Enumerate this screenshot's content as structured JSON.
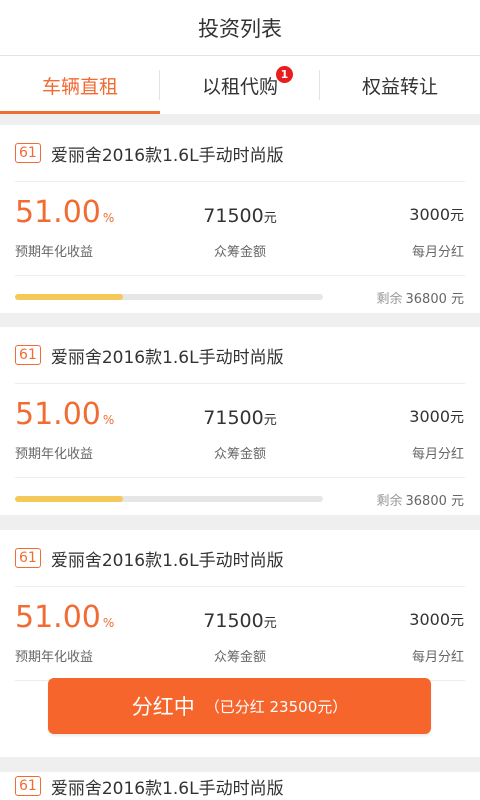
{
  "header": {
    "title": "投资列表"
  },
  "tabs": [
    {
      "label": "车辆直租",
      "active": true
    },
    {
      "label": "以租代购",
      "badge": "1"
    },
    {
      "label": "权益转让"
    }
  ],
  "colors": {
    "accent": "#f26b33",
    "progress": "#f5c85a",
    "badge": "#e81d1d"
  },
  "cards": [
    {
      "tag": "61",
      "name": "爱丽舍2016款1.6L手动时尚版",
      "rate": "51.00",
      "rate_unit": "%",
      "rate_label": "预期年化收益",
      "amount": "71500",
      "amount_unit": "元",
      "amount_label": "众筹金额",
      "monthly": "3000",
      "monthly_unit": "元",
      "monthly_label": "每月分红",
      "progress_fraction": 0.35,
      "remain_label": "剩余",
      "remain_value": "36800 元"
    },
    {
      "tag": "61",
      "name": "爱丽舍2016款1.6L手动时尚版",
      "rate": "51.00",
      "rate_unit": "%",
      "rate_label": "预期年化收益",
      "amount": "71500",
      "amount_unit": "元",
      "amount_label": "众筹金额",
      "monthly": "3000",
      "monthly_unit": "元",
      "monthly_label": "每月分红",
      "progress_fraction": 0.35,
      "remain_label": "剩余",
      "remain_value": "36800 元"
    },
    {
      "tag": "61",
      "name": "爱丽舍2016款1.6L手动时尚版",
      "rate": "51.00",
      "rate_unit": "%",
      "rate_label": "预期年化收益",
      "amount": "71500",
      "amount_unit": "元",
      "amount_label": "众筹金额",
      "monthly": "3000",
      "monthly_unit": "元",
      "monthly_label": "每月分红",
      "button_label": "分红中",
      "button_sub": "（已分红 23500元）"
    },
    {
      "tag": "61",
      "name": "爱丽舍2016款1.6L手动时尚版"
    }
  ]
}
